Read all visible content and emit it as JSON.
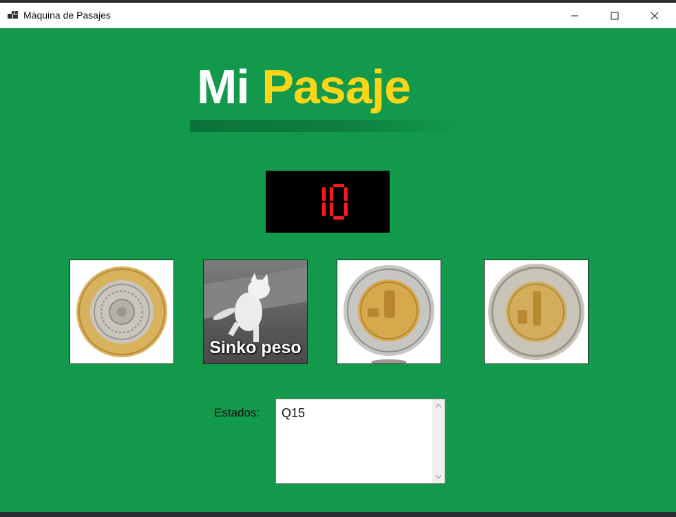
{
  "window": {
    "title": "Máquina de Pasajes",
    "icon": "app-window-icon",
    "controls": [
      "minimize-icon",
      "maximize-icon",
      "close-icon"
    ]
  },
  "logo": {
    "part1": "Mi",
    "part2": "Pasaje",
    "colors": {
      "mi": "#ffffff",
      "pasaje": "#fcd518"
    }
  },
  "display": {
    "value": "10",
    "color": "#ff1a1a",
    "background": "#000000"
  },
  "coins": [
    {
      "name": "ten-peso-coin",
      "denomination": 10
    },
    {
      "name": "five-peso-meme",
      "denomination": 5,
      "caption": "Sinko peso"
    },
    {
      "name": "two-peso-coin",
      "denomination": 2
    },
    {
      "name": "one-peso-coin",
      "denomination": 1
    }
  ],
  "status": {
    "label": "Estados:",
    "value": "Q15"
  },
  "colors": {
    "background": "#12994c",
    "titlebar": "#ffffff"
  }
}
